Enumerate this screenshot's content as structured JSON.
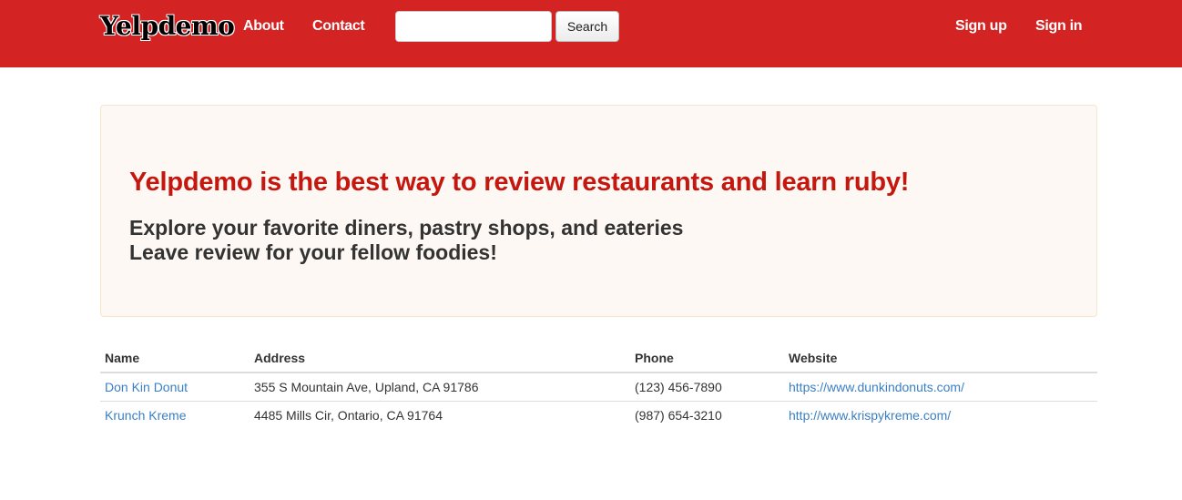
{
  "navbar": {
    "brand": "Yelpdemo",
    "links": [
      {
        "label": "About"
      },
      {
        "label": "Contact"
      }
    ],
    "search": {
      "placeholder": "",
      "value": "",
      "button_label": "Search"
    },
    "auth": [
      {
        "label": "Sign up"
      },
      {
        "label": "Sign in"
      }
    ]
  },
  "hero": {
    "title": "Yelpdemo is the best way to review restaurants and learn ruby!",
    "subtitle_line1": "Explore your favorite diners, pastry shops, and eateries",
    "subtitle_line2": "Leave review for your fellow foodies!"
  },
  "table": {
    "headers": [
      "Name",
      "Address",
      "Phone",
      "Website"
    ],
    "rows": [
      {
        "name": "Don Kin Donut",
        "address": "355 S Mountain Ave, Upland, CA 91786",
        "phone": "(123) 456-7890",
        "website": "https://www.dunkindonuts.com/"
      },
      {
        "name": "Krunch Kreme",
        "address": "4485 Mills Cir, Ontario, CA 91764",
        "phone": "(987) 654-3210",
        "website": "http://www.krispykreme.com/"
      }
    ]
  },
  "colors": {
    "navbar_bg": "#d42323",
    "hero_title": "#c4170f",
    "link": "#3a7fc4",
    "hero_bg": "#fdf8f3"
  }
}
